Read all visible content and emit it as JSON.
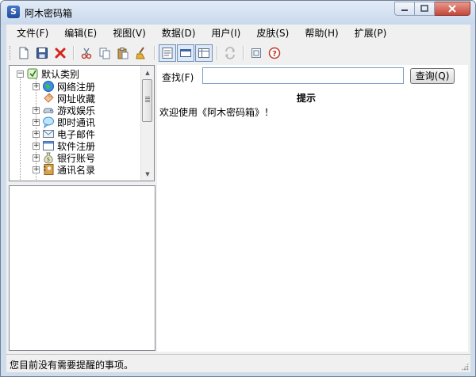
{
  "window": {
    "title": "阿木密码箱",
    "app_icon_letter": "S"
  },
  "menu": [
    {
      "label": "文件(F)"
    },
    {
      "label": "编辑(E)"
    },
    {
      "label": "视图(V)"
    },
    {
      "label": "数据(D)"
    },
    {
      "label": "用户(I)"
    },
    {
      "label": "皮肤(S)"
    },
    {
      "label": "帮助(H)"
    },
    {
      "label": "扩展(P)"
    }
  ],
  "toolbar": {
    "buttons": [
      {
        "icon": "new-file-icon"
      },
      {
        "icon": "save-icon"
      },
      {
        "icon": "delete-icon"
      },
      {
        "icon": "cut-icon"
      },
      {
        "icon": "copy-icon"
      },
      {
        "icon": "paste-icon"
      },
      {
        "icon": "clear-icon"
      },
      {
        "icon": "view-detail-icon",
        "pressed": true
      },
      {
        "icon": "view-list-icon",
        "pressed": true
      },
      {
        "icon": "view-layout-icon",
        "pressed": true
      },
      {
        "icon": "refresh-icon",
        "disabled": true
      },
      {
        "icon": "properties-icon"
      },
      {
        "icon": "help-icon"
      }
    ]
  },
  "tree": {
    "root": {
      "label": "默认类别",
      "icon": "category-icon"
    },
    "items": [
      {
        "label": "网络注册",
        "icon": "globe-icon",
        "expandable": true
      },
      {
        "label": "网址收藏",
        "icon": "bookmark-icon",
        "expandable": false
      },
      {
        "label": "游戏娱乐",
        "icon": "game-icon",
        "expandable": true
      },
      {
        "label": "即时通讯",
        "icon": "chat-icon",
        "expandable": true
      },
      {
        "label": "电子邮件",
        "icon": "mail-icon",
        "expandable": true
      },
      {
        "label": "软件注册",
        "icon": "software-icon",
        "expandable": true
      },
      {
        "label": "银行账号",
        "icon": "money-bag-icon",
        "expandable": true
      },
      {
        "label": "通讯名录",
        "icon": "address-book-icon",
        "expandable": true
      }
    ]
  },
  "search": {
    "label": "查找(F)",
    "value": "",
    "button_label": "查询(Q)"
  },
  "content": {
    "tip_title": "提示",
    "welcome": "欢迎使用《阿木密码箱》！"
  },
  "status": {
    "text": "您目前没有需要提醒的事项。"
  },
  "colors": {
    "accent": "#3a6fb5",
    "delete_red": "#d4241c",
    "title_bar": "#c8d8ec",
    "close_button": "#c5473a"
  }
}
